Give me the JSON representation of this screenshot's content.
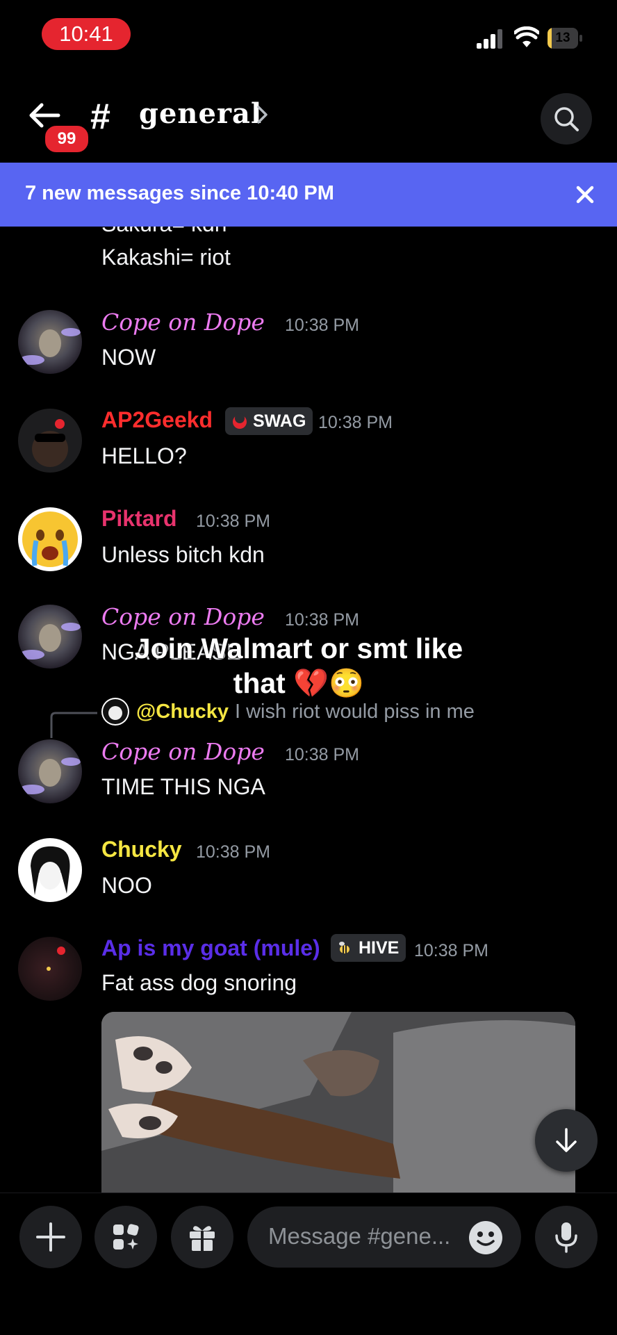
{
  "status_bar": {
    "time": "10:41",
    "battery": "13",
    "battery_level": 0.13
  },
  "header": {
    "back_badge": "99",
    "hash": "#",
    "channel": "general"
  },
  "banner": {
    "text": "7 new messages since 10:40 PM"
  },
  "partial_message": {
    "line1": "Sakura= kdn",
    "line2": "Kakashi= riot"
  },
  "messages": [
    {
      "author": "Cope on Dope",
      "time": "10:38 PM",
      "text": "NOW"
    },
    {
      "author": "AP2Geekd",
      "tag": "SWAG",
      "time": "10:38 PM",
      "text": "HELLO?"
    },
    {
      "author": "Piktard",
      "time": "10:38 PM",
      "text": "Unless bitch kdn"
    },
    {
      "author": "Cope on Dope",
      "time": "10:38 PM",
      "text": "NGA PLEASE"
    },
    {
      "author": "Cope on Dope",
      "time": "10:38 PM",
      "text": "TIME THIS NGA",
      "reply": {
        "mention": "@Chucky",
        "text": "I wish riot would piss in me"
      }
    },
    {
      "author": "Chucky",
      "time": "10:38 PM",
      "text": "NOO"
    },
    {
      "author": "Ap is my goat (mule)",
      "tag": "HIVE",
      "time": "10:38 PM",
      "text": "Fat ass dog snoring"
    }
  ],
  "overlay_caption": {
    "line1": "Join Walmart or smt like",
    "line2": "that 💔😳"
  },
  "composer": {
    "placeholder": "Message #gene..."
  },
  "colors": {
    "accent": "#5865f2",
    "danger": "#e5252f",
    "cursive_name": "#ec7bf0",
    "ap2geekd": "#ff2d2d",
    "piktard": "#e8336d",
    "chucky": "#f5e642",
    "ap_goat": "#5a2ee8"
  },
  "icons": [
    "back-arrow-icon",
    "search-icon",
    "close-icon",
    "plus-icon",
    "apps-icon",
    "gift-icon",
    "emoji-icon",
    "microphone-icon",
    "arrow-down-icon"
  ]
}
